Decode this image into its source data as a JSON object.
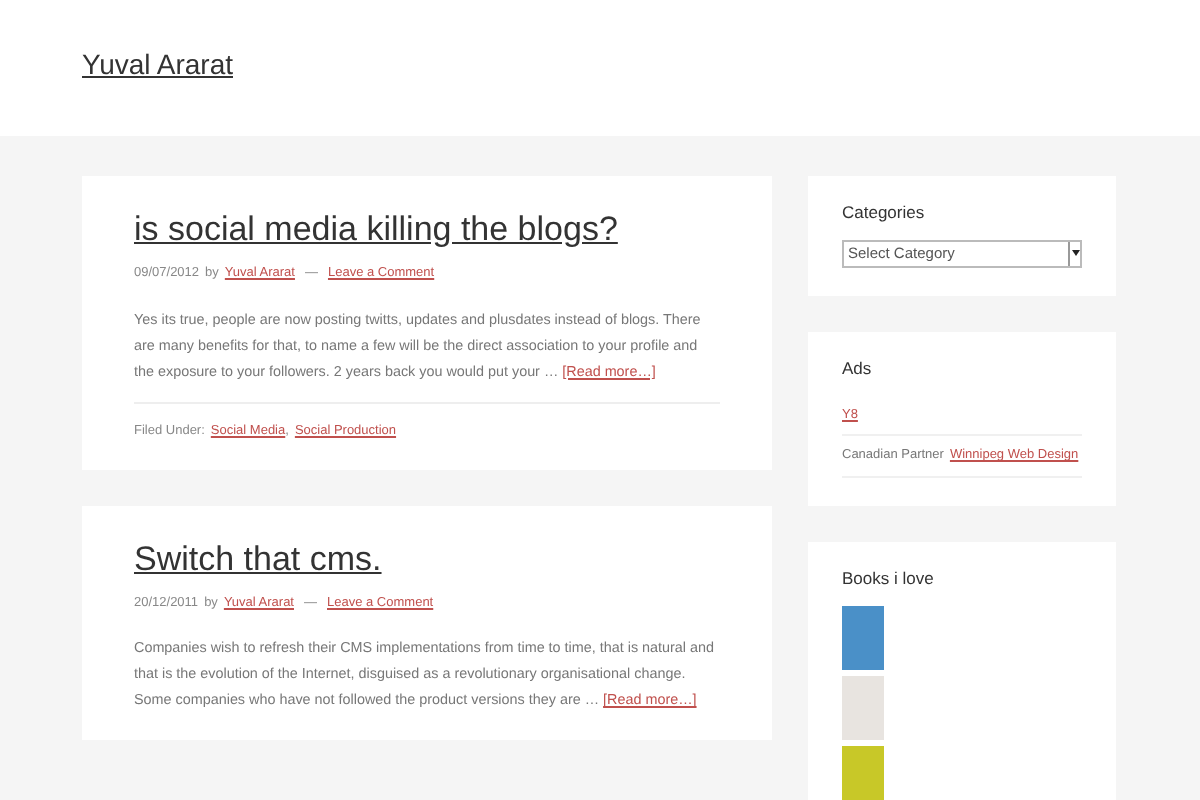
{
  "site_title": "Yuval Ararat",
  "posts": [
    {
      "title": "is social media killing the blogs?",
      "date": "09/07/2012",
      "by": "by",
      "author": "Yuval Ararat",
      "separator": "—",
      "comment_link": "Leave a Comment",
      "excerpt": "Yes its true, people are now posting twitts, updates and plusdates instead of blogs. There are many benefits for that, to name a few will be the direct association to your profile and the exposure to your followers. 2 years back you would put your …",
      "read_more": "[Read more…]",
      "filed_label": "Filed Under:",
      "category_separator": ",",
      "categories": [
        "Social Media",
        "Social Production"
      ]
    },
    {
      "title": "Switch that cms.",
      "date": "20/12/2011",
      "by": "by",
      "author": "Yuval Ararat",
      "separator": "—",
      "comment_link": "Leave a Comment",
      "excerpt": "Companies wish to refresh their CMS implementations from time to time, that is natural and that is the evolution of the Internet, disguised as a revolutionary organisational change. Some companies who have not followed the product versions they are …",
      "read_more": "[Read more…]"
    }
  ],
  "sidebar": [
    {
      "kind": "select",
      "title": "Categories",
      "value": "Select Category"
    },
    {
      "kind": "links",
      "title": "Ads",
      "items": [
        {
          "text": "Y8"
        },
        {
          "prefix": "Canadian Partner",
          "text": "Winnipeg Web Design"
        }
      ]
    },
    {
      "kind": "books",
      "title": "Books i love",
      "books": [
        {
          "color": "#4a90c8"
        },
        {
          "color": "#e8e4e0"
        },
        {
          "color": "#c8c828"
        }
      ]
    }
  ]
}
